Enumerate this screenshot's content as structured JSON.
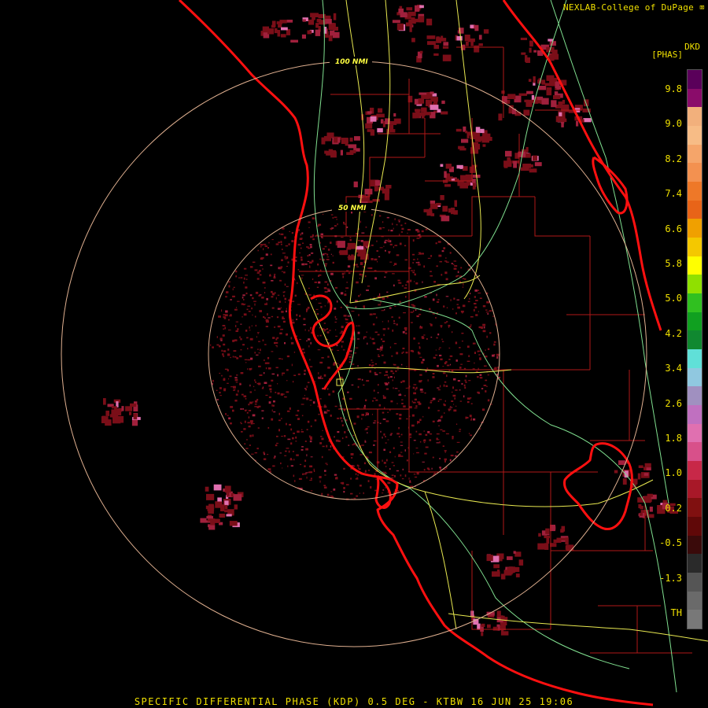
{
  "header": {
    "credit": "NEXLAB-College of DuPage"
  },
  "legend": {
    "title_line1": "DKD",
    "title_line2": "[PHAS]",
    "ticks": [
      "9.8",
      "9.0",
      "8.2",
      "7.4",
      "6.6",
      "5.8",
      "5.0",
      "4.2",
      "3.4",
      "2.6",
      "1.8",
      "1.0",
      "0.2",
      "-0.5",
      "-1.3",
      "TH"
    ],
    "colors": [
      "#5a005a",
      "#8a0c6a",
      "#f2b07c",
      "#f7bc86",
      "#f5a56a",
      "#f39150",
      "#ee7828",
      "#e86418",
      "#f0a000",
      "#f4c800",
      "#ffff00",
      "#90e000",
      "#30c020",
      "#10a020",
      "#108830",
      "#60e0d8",
      "#90c8e0",
      "#a090c0",
      "#c070c0",
      "#e070b0",
      "#d8508a",
      "#c82848",
      "#a81828",
      "#801010",
      "#600808",
      "#3a0a0a",
      "#2a2a2a",
      "#555555",
      "#6a6a6a",
      "#787878"
    ]
  },
  "map": {
    "range_rings": [
      {
        "label": "50 NMI"
      },
      {
        "label": "100 NMI"
      }
    ],
    "colors": {
      "coast": "#ff1010",
      "county": "#b01818",
      "highway": "#e8e850",
      "interstate": "#80e090",
      "ring": "#e0b090",
      "echo_low": "#7a0e18",
      "echo_mid": "#a0203c",
      "echo_high": "#e070b0"
    }
  },
  "caption": "SPECIFIC DIFFERENTIAL PHASE (KDP) 0.5 DEG - KTBW 16 JUN 25 19:06"
}
